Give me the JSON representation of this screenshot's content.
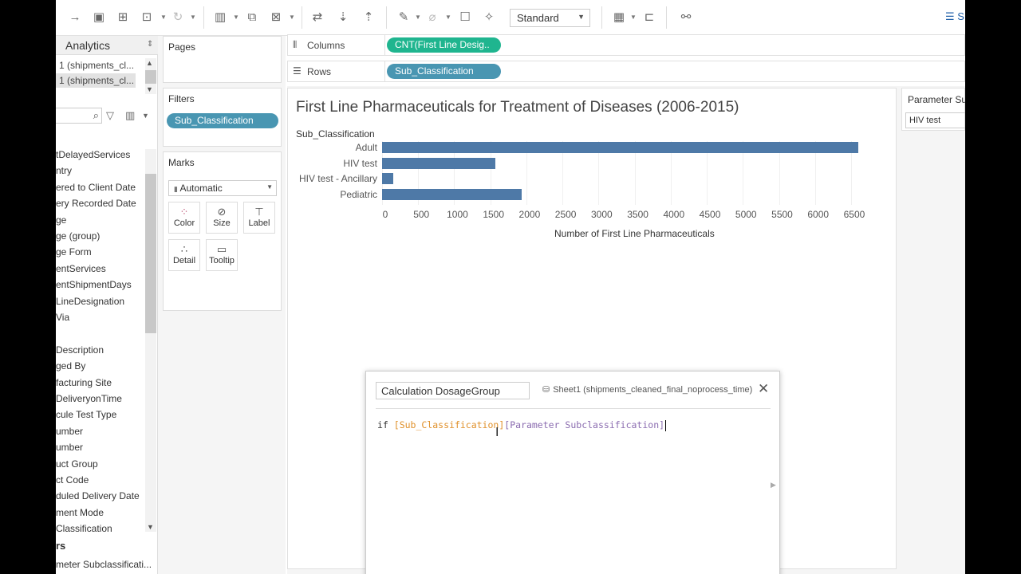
{
  "toolbar": {
    "view_size": "Standard",
    "right_label": "S"
  },
  "data_pane": {
    "analytics_tab": "Analytics",
    "datasources": [
      "1 (shipments_cl...",
      "1 (shipments_cl..."
    ],
    "fields": [
      "tDelayedServices",
      "ntry",
      "ered to Client Date",
      "ery Recorded Date",
      "ge",
      "ge (group)",
      "ge Form",
      "entServices",
      "entShipmentDays",
      "LineDesignation",
      " Via",
      "",
      " Description",
      "ged By",
      "facturing Site",
      "DeliveryonTime",
      "cule Test Type",
      "umber",
      "umber",
      "uct Group",
      "ct Code",
      "duled Delivery Date",
      "ment Mode",
      "Classification"
    ],
    "parameters_header": "rs",
    "parameter_field": "meter Subclassificati..."
  },
  "cards": {
    "pages_title": "Pages",
    "filters_title": "Filters",
    "filter_pill": "Sub_Classification",
    "marks_title": "Marks",
    "mark_type": "Automatic",
    "buttons": {
      "color": "Color",
      "size": "Size",
      "label": "Label",
      "detail": "Detail",
      "tooltip": "Tooltip"
    }
  },
  "shelves": {
    "columns_label": "Columns",
    "columns_pill": "CNT(First Line Desig..",
    "rows_label": "Rows",
    "rows_pill": "Sub_Classification"
  },
  "view": {
    "title": "First Line Pharmaceuticals for Treatment of Diseases (2006-2015)",
    "row_header": "Sub_Classification"
  },
  "parameter_card": {
    "title": "Parameter Su",
    "value": "HIV test"
  },
  "calc_dialog": {
    "name": "Calculation DosageGroup",
    "datasource": "Sheet1 (shipments_cleaned_final_noprocess_time)",
    "code_keyword": "if ",
    "code_field": "[Sub_Classification]",
    "code_param": "[Parameter Subclassification]"
  },
  "chart_data": {
    "type": "bar",
    "orientation": "horizontal",
    "title": "First Line Pharmaceuticals for Treatment of Diseases (2006-2015)",
    "categories": [
      "Adult",
      "HIV test",
      "HIV test - Ancillary",
      "Pediatric"
    ],
    "values": [
      6600,
      1570,
      150,
      1940
    ],
    "xlabel": "Number of First Line Pharmaceuticals",
    "ylabel": "Sub_Classification",
    "xlim": [
      0,
      6600
    ],
    "ticks": [
      0,
      500,
      1000,
      1500,
      2000,
      2500,
      3000,
      3500,
      4000,
      4500,
      5000,
      5500,
      6000,
      6500
    ],
    "colors": [
      "#4e79a7"
    ],
    "grid": true
  }
}
